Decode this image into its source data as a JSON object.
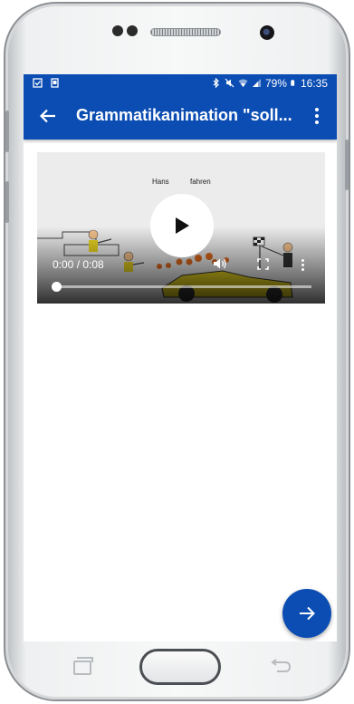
{
  "status_bar": {
    "battery": "79%",
    "time": "16:35",
    "icons": [
      "checkbox-icon",
      "document-icon",
      "bluetooth-icon",
      "mute-icon",
      "wifi-icon",
      "signal-icon",
      "battery-icon"
    ]
  },
  "app_bar": {
    "title": "Grammatikanimation \"soll...",
    "back_icon": "arrow-left-icon",
    "menu_icon": "more-vert-icon"
  },
  "video": {
    "time": "0:00 / 0:08",
    "word_1": "Hans",
    "word_2": "fahren",
    "progress": 0.0
  },
  "fab": {
    "icon": "arrow-right-icon"
  },
  "colors": {
    "primary": "#0b4db3",
    "background": "#ffffff",
    "video_bg": "#ececec"
  }
}
